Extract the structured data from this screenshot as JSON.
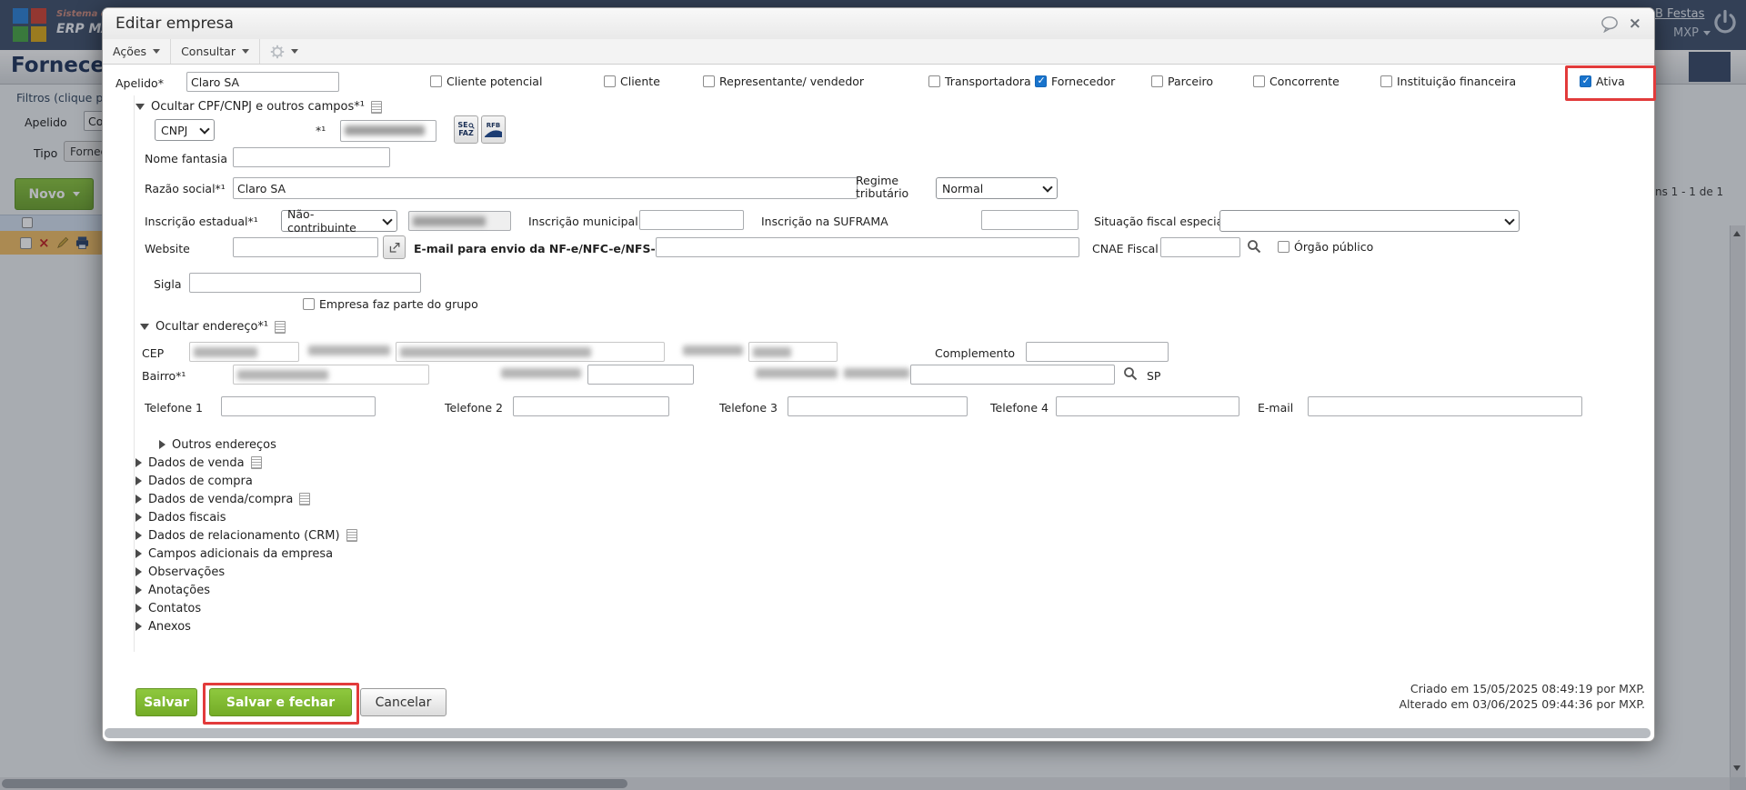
{
  "topbar": {
    "brand_small": "Sistema de gestão",
    "brand": "ERP MAXIPROD",
    "account": "B Festas",
    "user": "MXP"
  },
  "page": {
    "title": "Forneced",
    "filters_legend": "Filtros (clique pa",
    "apelido_label": "Apelido",
    "apelido_value": "Co",
    "tipo_label": "Tipo",
    "tipo_chip": "Fornec",
    "novo": "Novo",
    "pagination": "ns 1 - 1 de 1"
  },
  "modal": {
    "title": "Editar empresa",
    "toolbar": {
      "acoes": "Ações",
      "consultar": "Consultar"
    },
    "apelido": {
      "label": "Apelido*",
      "value": "Claro SA"
    },
    "types": [
      {
        "label": "Cliente potencial",
        "checked": false
      },
      {
        "label": "Cliente",
        "checked": false
      },
      {
        "label": "Representante/ vendedor",
        "checked": false
      },
      {
        "label": "Transportadora",
        "checked": false
      },
      {
        "label": "Fornecedor",
        "checked": true
      },
      {
        "label": "Parceiro",
        "checked": false
      },
      {
        "label": "Concorrente",
        "checked": false
      },
      {
        "label": "Instituição financeira",
        "checked": false
      },
      {
        "label": "Ativa",
        "checked": true,
        "highlighted": true
      }
    ],
    "cpf_section": {
      "header": "Ocultar CPF/CNPJ e outros campos*¹",
      "doc_type": "CNPJ",
      "req": "*¹",
      "sefaz_l1": "SE",
      "sefaz_l2": "FAZ",
      "rfb": "RFB"
    },
    "fields": {
      "nome_fantasia": {
        "label": "Nome fantasia",
        "value": ""
      },
      "razao_social": {
        "label": "Razão social*¹",
        "value": "Claro SA"
      },
      "regime_tributario": {
        "label": "Regime tributário",
        "value": "Normal"
      },
      "inscricao_estadual": {
        "label": "Inscrição estadual*¹",
        "value": "Não-contribuinte"
      },
      "inscricao_municipal": {
        "label": "Inscrição municipal",
        "value": ""
      },
      "suframa": {
        "label": "Inscrição na SUFRAMA",
        "value": ""
      },
      "situacao_fiscal": {
        "label": "Situação fiscal especial",
        "value": ""
      },
      "website": {
        "label": "Website",
        "value": ""
      },
      "email_nfe": {
        "label": "E-mail para envio da NF-e/NFC-e/NFS-e",
        "value": ""
      },
      "cnae": {
        "label": "CNAE Fiscal",
        "value": ""
      },
      "orgao_publico": {
        "label": "Órgão público",
        "checked": false
      },
      "sigla": {
        "label": "Sigla",
        "value": ""
      },
      "grupo": {
        "label": "Empresa faz parte do grupo",
        "checked": false
      }
    },
    "endereco_section": {
      "header": "Ocultar endereço*¹",
      "cep_label": "CEP",
      "complemento_label": "Complemento",
      "bairro_label": "Bairro*¹",
      "uf": "SP"
    },
    "telefones": {
      "t1": "Telefone 1",
      "t2": "Telefone 2",
      "t3": "Telefone 3",
      "t4": "Telefone 4",
      "email": "E-mail"
    },
    "sections": [
      {
        "label": "Outros endereços",
        "note": false
      },
      {
        "label": "Dados de venda",
        "note": true
      },
      {
        "label": "Dados de compra",
        "note": false
      },
      {
        "label": "Dados de venda/compra",
        "note": true
      },
      {
        "label": "Dados fiscais",
        "note": false
      },
      {
        "label": "Dados de relacionamento (CRM)",
        "note": true
      },
      {
        "label": "Campos adicionais da empresa",
        "note": false
      },
      {
        "label": "Observações",
        "note": false
      },
      {
        "label": "Anotações",
        "note": false
      },
      {
        "label": "Contatos",
        "note": false
      },
      {
        "label": "Anexos",
        "note": false
      }
    ],
    "footer": {
      "salvar": "Salvar",
      "salvar_fechar": "Salvar e fechar",
      "cancelar": "Cancelar",
      "criado": "Criado em 15/05/2025 08:49:19 por MXP.",
      "alterado": "Alterado em 03/06/2025 09:44:36 por MXP."
    }
  },
  "colors": {
    "accent_green": "#76b043",
    "highlight_red": "#e23b3b",
    "check_blue": "#1873cc",
    "navy": "#42526c",
    "row_highlight": "#f2bf66"
  }
}
